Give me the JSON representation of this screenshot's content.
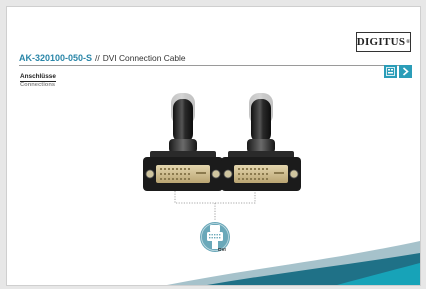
{
  "header": {
    "product_code": "AK-320100-050-S",
    "separator": "//",
    "product_name": "DVI Connection Cable",
    "brand": "DIGITUS",
    "brand_mark": "®"
  },
  "section": {
    "title_de": "Anschlüsse",
    "title_en": "Connections"
  },
  "connector": {
    "label": "DVI"
  },
  "colors": {
    "accent": "#2a86a8",
    "button": "#2b9db8",
    "connector_gold": "#d6c49a"
  },
  "icons": [
    "hd-icon",
    "next-arrow-icon",
    "dvi-connector-icon"
  ]
}
